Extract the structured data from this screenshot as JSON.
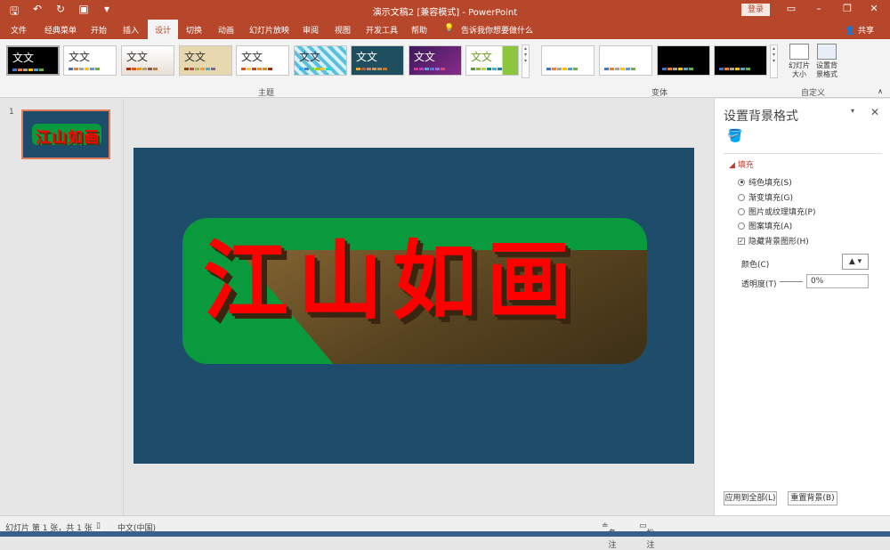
{
  "window": {
    "title": "演示文稿2 [兼容模式]  -  PowerPoint",
    "login_label": "登录",
    "share_label": "共享"
  },
  "tabs": [
    {
      "label": "文件"
    },
    {
      "label": "经典菜单"
    },
    {
      "label": "开始"
    },
    {
      "label": "插入"
    },
    {
      "label": "设计"
    },
    {
      "label": "切换"
    },
    {
      "label": "动画"
    },
    {
      "label": "幻灯片放映"
    },
    {
      "label": "审阅"
    },
    {
      "label": "视图"
    },
    {
      "label": "开发工具"
    },
    {
      "label": "帮助"
    }
  ],
  "tell_me": "告诉我你想要做什么",
  "ribbon": {
    "themes_label": "主题",
    "variants_label": "变体",
    "customize_label": "自定义",
    "theme_text": "文文",
    "slide_size_label": "幻灯片大小",
    "format_bg_label": "设置背景格式"
  },
  "slide": {
    "number": "1",
    "text": "江山如画"
  },
  "colors": {
    "accent": "#b7472a",
    "slide_bg": "#1e4d6b",
    "shape_fill": "#0a9a3e",
    "text": "#ff0000",
    "extrusion": "#6b4a26"
  },
  "format_pane": {
    "title": "设置背景格式",
    "section": "填充",
    "options": [
      {
        "label": "纯色填充(S)",
        "checked": true
      },
      {
        "label": "渐变填充(G)",
        "checked": false
      },
      {
        "label": "图片或纹理填充(P)",
        "checked": false
      },
      {
        "label": "图案填充(A)",
        "checked": false
      }
    ],
    "hide_bg_graphics": "隐藏背景图形(H)",
    "color_label": "颜色(C)",
    "transparency_label": "透明度(T)",
    "transparency_value": "0%",
    "apply_all": "应用到全部(L)",
    "reset_bg": "重置背景(B)"
  },
  "status": {
    "slide_info": "幻灯片 第 1 张，共 1 张",
    "language": "中文(中国)",
    "notes": "备注",
    "comments": "批注"
  }
}
